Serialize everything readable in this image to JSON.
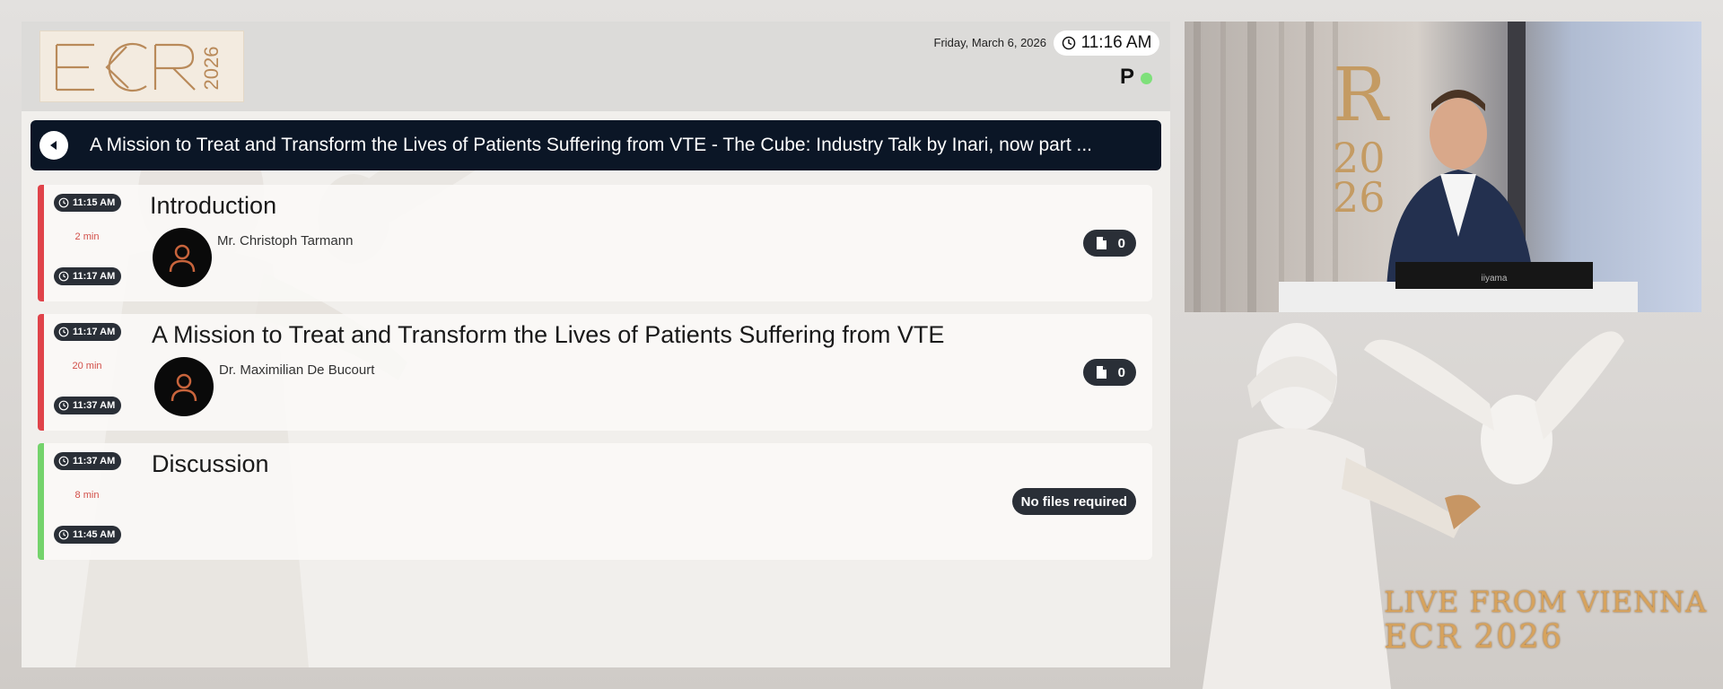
{
  "header": {
    "logo_text": "ECR",
    "logo_year": "2026",
    "date": "Friday, March 6, 2026",
    "time": "11:16 AM",
    "status_letter": "P"
  },
  "session": {
    "title": "A Mission to Treat and Transform the Lives of Patients Suffering from VTE - The Cube: Industry Talk by Inari, now part ..."
  },
  "talks": [
    {
      "start": "11:15 AM",
      "duration": "2 min",
      "end": "11:17 AM",
      "title": "Introduction",
      "speaker": "Mr. Christoph Tarmann",
      "files": "0",
      "status_color": "#e0434a"
    },
    {
      "start": "11:17 AM",
      "duration": "20 min",
      "end": "11:37 AM",
      "title": "A Mission to Treat and Transform the Lives of Patients Suffering from VTE",
      "speaker": "Dr. Maximilian De Bucourt",
      "files": "0",
      "status_color": "#e0434a"
    },
    {
      "start": "11:37 AM",
      "duration": "8 min",
      "end": "11:45 AM",
      "title": "Discussion",
      "files_label": "No files required",
      "status_color": "#74d36c"
    }
  ],
  "branding": {
    "live_text": "LIVE FROM VIENNA",
    "event_text": "ECR 2026",
    "accent": "#d7a35d"
  },
  "icons": {
    "clock": "clock-icon",
    "back": "back-arrow-icon",
    "file": "file-icon",
    "avatar": "person-icon"
  }
}
